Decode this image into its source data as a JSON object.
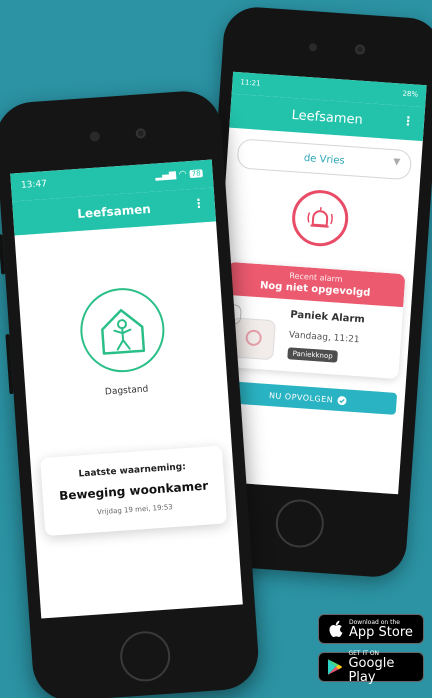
{
  "back_phone": {
    "status_time": "11:21",
    "status_right": "28%",
    "app_title": "Leefsamen",
    "menu_icon": "⋮",
    "selected_person": "de Vries",
    "alarm": {
      "subtitle": "Recent alarm",
      "status": "Nog niet opgevolgd",
      "name": "Paniek Alarm",
      "time": "Vandaag, 11:21",
      "tag": "Paniekknop",
      "button": "NU OPVOLGEN",
      "accent": "#ec5a6f"
    }
  },
  "front_phone": {
    "status_time": "13:47",
    "battery": "78",
    "app_title": "Leefsamen",
    "menu_icon": "⋮",
    "mode_label": "Dagstand",
    "card": {
      "label": "Laatste waarneming:",
      "value": "Beweging woonkamer",
      "date": "Vrijdag 19 mei, 19:53"
    }
  },
  "badges": {
    "apple_small": "Download on the",
    "apple_big": "App Store",
    "google_small": "GET IT ON",
    "google_big": "Google Play"
  },
  "colors": {
    "background": "#2b93a4",
    "brand": "#22c3aa",
    "house_icon": "#2bbf88",
    "follow_button": "#2ab3c2"
  }
}
